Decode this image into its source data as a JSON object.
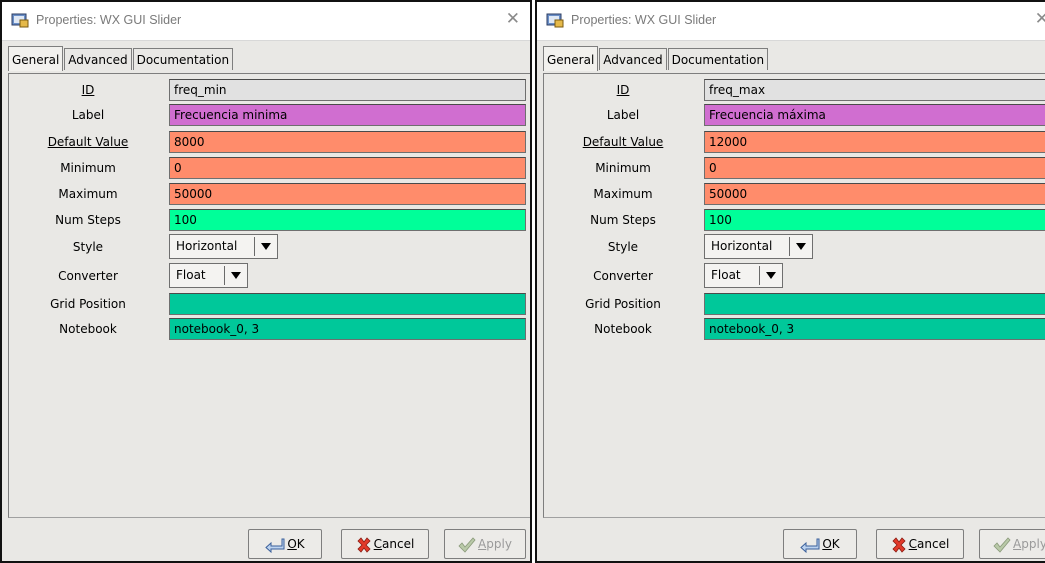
{
  "colors": {
    "id_bg": "#e1e1e1",
    "label_bg": "#d06ed0",
    "numeric_bg": "#ff8c6b",
    "steps_bg": "#00ff99",
    "grid_bg": "#00c89a"
  },
  "dialogs": [
    {
      "title": "Properties: WX GUI Slider",
      "tabs": [
        "General",
        "Advanced",
        "Documentation"
      ],
      "params": {
        "id": {
          "label": "ID",
          "value": "freq_min"
        },
        "label": {
          "label": "Label",
          "value": "Frecuencia minima"
        },
        "default": {
          "label": "Default Value",
          "value": "8000"
        },
        "minimum": {
          "label": "Minimum",
          "value": "0"
        },
        "maximum": {
          "label": "Maximum",
          "value": "50000"
        },
        "num_steps": {
          "label": "Num Steps",
          "value": "100"
        },
        "style": {
          "label": "Style",
          "value": "Horizontal"
        },
        "converter": {
          "label": "Converter",
          "value": "Float"
        },
        "grid_position": {
          "label": "Grid Position",
          "value": ""
        },
        "notebook": {
          "label": "Notebook",
          "value": "notebook_0, 3"
        }
      },
      "buttons": {
        "ok": "OK",
        "cancel": "Cancel",
        "apply": "Apply"
      }
    },
    {
      "title": "Properties: WX GUI Slider",
      "tabs": [
        "General",
        "Advanced",
        "Documentation"
      ],
      "params": {
        "id": {
          "label": "ID",
          "value": "freq_max"
        },
        "label": {
          "label": "Label",
          "value": "Frecuencia máxima"
        },
        "default": {
          "label": "Default Value",
          "value": "12000"
        },
        "minimum": {
          "label": "Minimum",
          "value": "0"
        },
        "maximum": {
          "label": "Maximum",
          "value": "50000"
        },
        "num_steps": {
          "label": "Num Steps",
          "value": "100"
        },
        "style": {
          "label": "Style",
          "value": "Horizontal"
        },
        "converter": {
          "label": "Converter",
          "value": "Float"
        },
        "grid_position": {
          "label": "Grid Position",
          "value": ""
        },
        "notebook": {
          "label": "Notebook",
          "value": "notebook_0, 3"
        }
      },
      "buttons": {
        "ok": "OK",
        "cancel": "Cancel",
        "apply": "Apply"
      }
    }
  ]
}
